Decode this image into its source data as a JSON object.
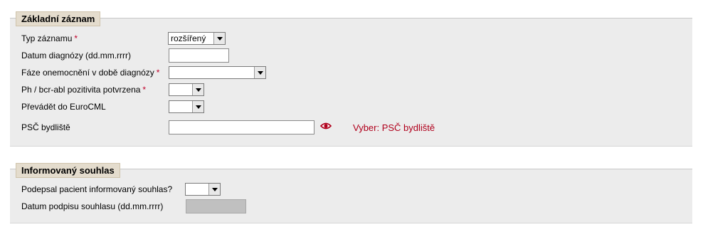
{
  "basic_record": {
    "legend": "Základní záznam",
    "record_type": {
      "label": "Typ záznamu",
      "required": "*",
      "value": "rozšířený"
    },
    "diagnosis_date": {
      "label": "Datum diagnózy (dd.mm.rrrr)",
      "value": ""
    },
    "disease_phase": {
      "label": "Fáze onemocnění v době diagnózy",
      "required": "*",
      "value": ""
    },
    "ph_bcr_abl": {
      "label": "Ph / bcr-abl pozitivita potvrzena",
      "required": "*",
      "value": ""
    },
    "transfer_eurocml": {
      "label": "Převádět do EuroCML",
      "value": ""
    },
    "postcode": {
      "label": "PSČ bydliště",
      "value": "",
      "picker_label": "Vyber: PSČ bydliště",
      "icon": "eye-icon"
    }
  },
  "informed_consent": {
    "legend": "Informovaný souhlas",
    "signed": {
      "label": "Podepsal pacient informovaný souhlas?",
      "value": ""
    },
    "signature_date": {
      "label": "Datum podpisu souhlasu (dd.mm.rrrr)",
      "value": ""
    }
  },
  "colors": {
    "panel_bg": "#ececec",
    "legend_bg": "#e4dccd",
    "required": "#c0002a",
    "link": "#b0001c"
  }
}
